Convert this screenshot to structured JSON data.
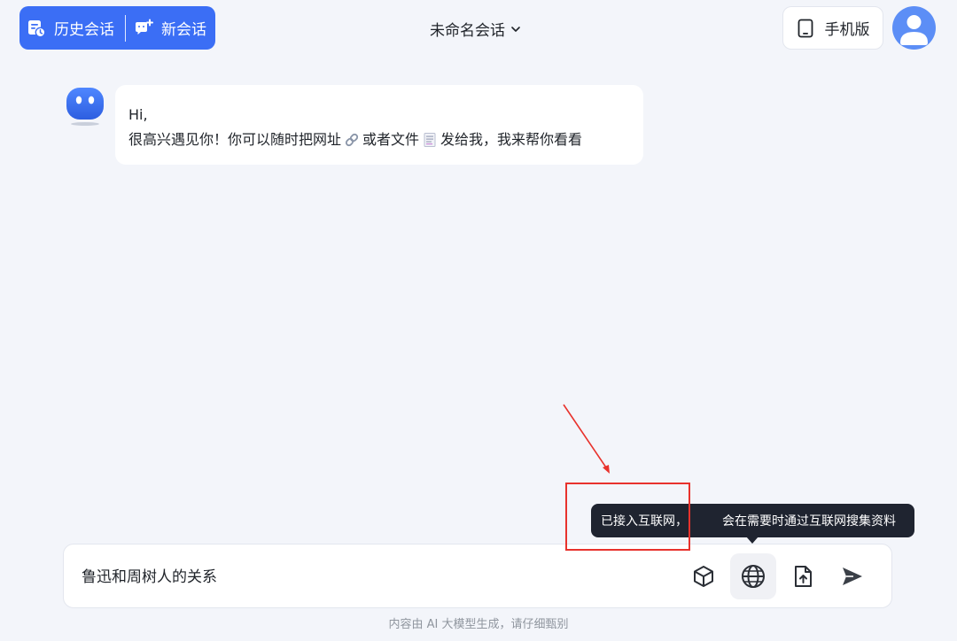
{
  "header": {
    "history_label": "历史会话",
    "new_chat_label": "新会话",
    "title": "未命名会话",
    "mobile_label": "手机版"
  },
  "chat": {
    "greeting": "Hi,",
    "message_part1": "很高兴遇见你！你可以随时把网址",
    "message_part2": "或者文件",
    "message_part3": "发给我，我来帮你看看"
  },
  "tooltip": {
    "part1": "已接入互联网，",
    "part2": "会在需要时通过互联网搜集资料"
  },
  "input": {
    "value": "鲁迅和周树人的关系"
  },
  "footer": {
    "note": "内容由 AI 大模型生成，请仔细甄别"
  },
  "colors": {
    "accent": "#3b6ef5",
    "annotation": "#e8322c",
    "tooltip_bg": "#1f2430",
    "page_bg": "#f3f5fa"
  },
  "icons": [
    "history-icon",
    "new-chat-icon",
    "chevron-down-icon",
    "phone-icon",
    "user-avatar-icon",
    "bot-avatar-icon",
    "link-icon",
    "document-icon",
    "cube-icon",
    "globe-icon",
    "file-upload-icon",
    "send-icon"
  ]
}
